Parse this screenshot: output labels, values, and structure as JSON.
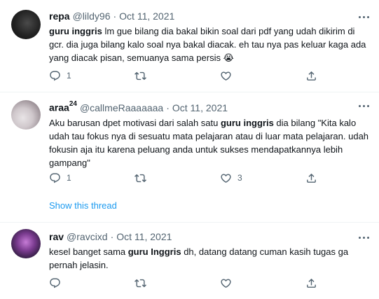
{
  "tweets": [
    {
      "display_name": "repa",
      "display_sup": "",
      "handle": "@lildy96",
      "dot": "·",
      "date": "Oct 11, 2021",
      "text_parts": [
        {
          "bold": true,
          "text": "guru inggris"
        },
        {
          "bold": false,
          "text": " lm gue bilang dia bakal bikin soal dari pdf yang udah dikirim di gcr. dia juga bilang kalo soal nya bakal diacak. eh tau nya pas keluar kaga ada yang diacak pisan, semuanya sama persis 😭"
        }
      ],
      "reply_count": "1",
      "retweet_count": "",
      "like_count": ""
    },
    {
      "display_name": "araa",
      "display_sup": "24",
      "handle": "@callmeRaaaaaaa",
      "dot": "·",
      "date": "Oct 11, 2021",
      "text_parts": [
        {
          "bold": false,
          "text": "Aku barusan dpet motivasi dari salah satu "
        },
        {
          "bold": true,
          "text": "guru inggris"
        },
        {
          "bold": false,
          "text": " dia bilang \"Kita kalo udah tau fokus nya di sesuatu mata pelajaran atau di luar mata pelajaran. udah fokusin aja itu karena peluang anda untuk sukses mendapatkannya lebih gampang\""
        }
      ],
      "reply_count": "1",
      "retweet_count": "",
      "like_count": "3",
      "show_thread": "Show this thread"
    },
    {
      "display_name": "rav",
      "display_sup": "",
      "handle": "@ravcixd",
      "dot": "·",
      "date": "Oct 11, 2021",
      "text_parts": [
        {
          "bold": false,
          "text": "kesel banget sama "
        },
        {
          "bold": true,
          "text": "guru Inggris"
        },
        {
          "bold": false,
          "text": " dh, datang datang cuman kasih tugas ga pernah jelasin."
        }
      ],
      "reply_count": "",
      "retweet_count": "",
      "like_count": ""
    }
  ],
  "icons": {
    "reply": "reply-icon",
    "retweet": "retweet-icon",
    "like": "like-icon",
    "share": "share-icon",
    "more": "more-icon"
  },
  "colors": {
    "text": "#0f1419",
    "secondary": "#536471",
    "link": "#1d9bf0",
    "divider": "#eff3f4"
  }
}
